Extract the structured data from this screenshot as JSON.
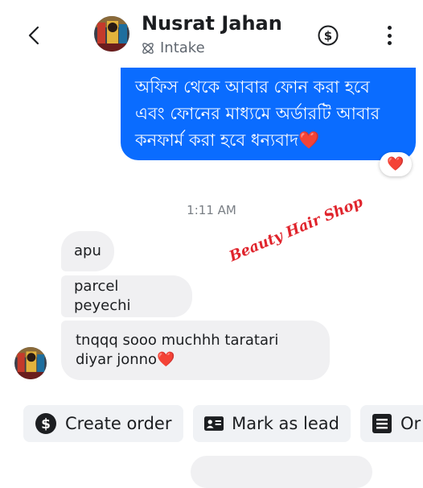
{
  "header": {
    "contact_name": "Nusrat Jahan",
    "label_tag": "Intake",
    "back_icon": "chevron-left-icon",
    "payment_icon": "dollar-circle-icon",
    "menu_icon": "more-vertical-icon"
  },
  "messages": {
    "outgoing_text": "অফিস থেকে আবার ফোন করা হবে এবং ফোনের মাধ্যমে অর্ডারটি আবার কনফার্ম করা হবে ধন্যবাদ❤️",
    "outgoing_reaction": "❤️",
    "timestamp": "1:11 AM",
    "incoming": [
      {
        "text": "apu"
      },
      {
        "text": "parcel peyechi"
      },
      {
        "text": "tnqqq sooo muchhh taratari diyar jonno❤️"
      }
    ]
  },
  "watermark": "Beauty Hair Shop",
  "quick_actions": [
    {
      "label": "Create order",
      "icon": "dollar-circle-icon"
    },
    {
      "label": "Mark as lead",
      "icon": "id-card-icon"
    },
    {
      "label": "Or",
      "icon": "document-list-icon"
    }
  ],
  "colors": {
    "accent": "#0a6cff",
    "incoming_bubble": "#f0f0f2",
    "chip_bg": "#f0f2f5",
    "watermark": "#e0242c"
  }
}
